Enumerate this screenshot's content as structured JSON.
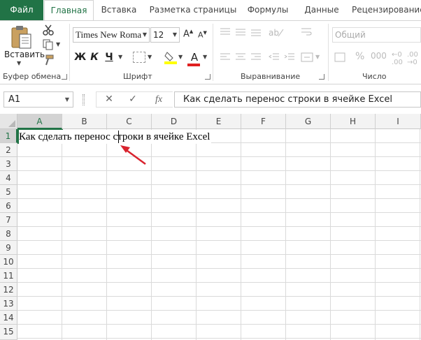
{
  "tabs": {
    "file": "Файл",
    "items": [
      "Главная",
      "Вставка",
      "Разметка страницы",
      "Формулы",
      "Данные",
      "Рецензирование"
    ]
  },
  "ribbon": {
    "clipboard": {
      "paste_label": "Вставить",
      "group_label": "Буфер обмена"
    },
    "font": {
      "font_name": "Times New Roma",
      "font_size": "12",
      "bold": "Ж",
      "italic": "К",
      "underline": "Ч",
      "font_color_glyph": "А",
      "group_label": "Шрифт",
      "font_color": "#e02020",
      "fill_color": "#ffff00"
    },
    "alignment": {
      "group_label": "Выравнивание"
    },
    "number": {
      "format": "Общий",
      "group_label": "Число"
    }
  },
  "formula_bar": {
    "name_box": "A1",
    "cancel": "✕",
    "enter": "✓",
    "fx": "fx",
    "content": "Как сделать перенос строки в ячейке Excel"
  },
  "grid": {
    "columns": [
      "A",
      "B",
      "C",
      "D",
      "E",
      "F",
      "G",
      "H",
      "I"
    ],
    "rows": [
      "1",
      "2",
      "3",
      "4",
      "5",
      "6",
      "7",
      "8",
      "9",
      "10",
      "11",
      "12",
      "13",
      "14",
      "15"
    ],
    "active_cell": "A1",
    "cell_a1_text": "Как сделать перенос строки в ячейке Excel"
  },
  "colors": {
    "accent": "#217346",
    "annotation_arrow": "#d9232e"
  }
}
